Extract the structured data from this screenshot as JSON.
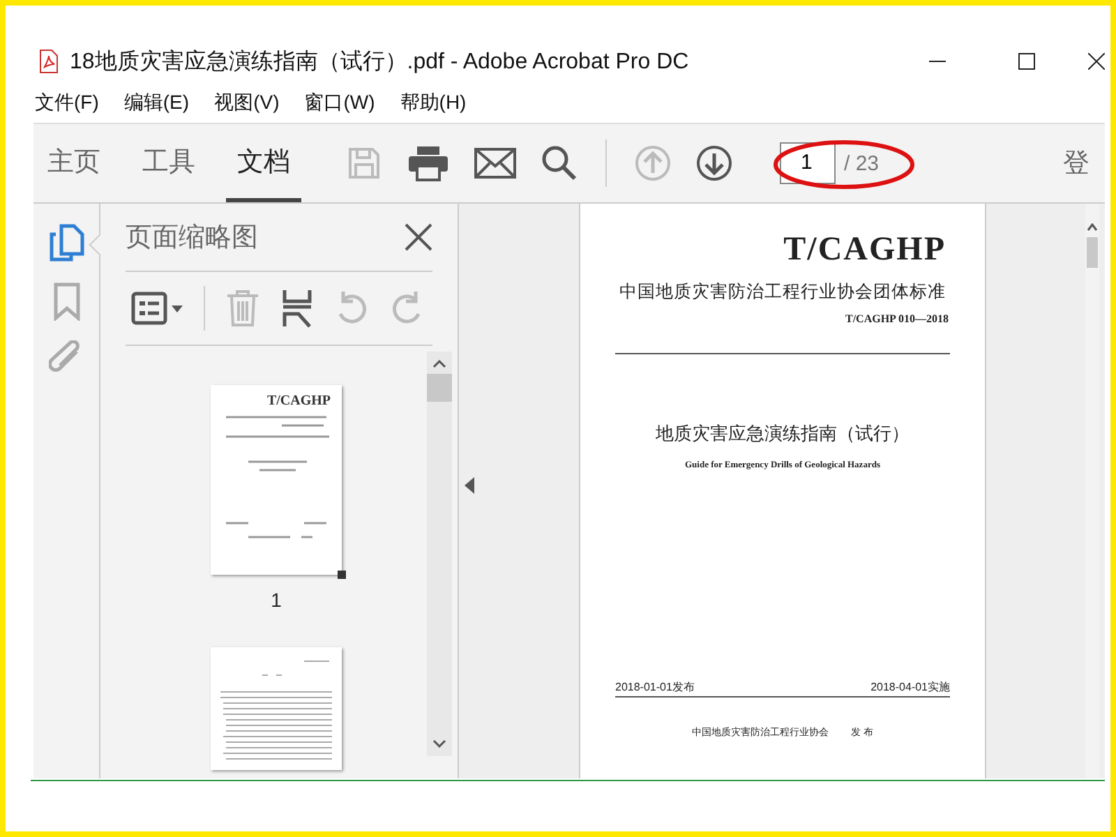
{
  "window": {
    "title": "18地质灾害应急演练指南（试行）.pdf - Adobe Acrobat Pro DC"
  },
  "menu": [
    "文件(F)",
    "编辑(E)",
    "视图(V)",
    "窗口(W)",
    "帮助(H)"
  ],
  "tabs": [
    {
      "label": "主页",
      "selected": false
    },
    {
      "label": "工具",
      "selected": false
    },
    {
      "label": "文档",
      "selected": true
    }
  ],
  "toolbar": {
    "buttons": [
      {
        "kind": "save",
        "disabled": true
      },
      {
        "kind": "print",
        "disabled": false
      },
      {
        "kind": "mail",
        "disabled": false
      },
      {
        "kind": "search",
        "disabled": false
      },
      {
        "kind": "up",
        "disabled": true
      },
      {
        "kind": "down",
        "disabled": false
      }
    ],
    "page_input": "1",
    "page_total": "/ 23",
    "sign_in": "登"
  },
  "side_rail": [
    {
      "kind": "pages",
      "selected": true
    },
    {
      "kind": "bookmarks",
      "selected": false
    },
    {
      "kind": "attachments",
      "selected": false
    }
  ],
  "thumbnail_panel": {
    "title": "页面缩略图",
    "tools": [
      {
        "kind": "options",
        "disabled": false
      },
      {
        "kind": "delete",
        "disabled": true
      },
      {
        "kind": "insert",
        "disabled": false
      },
      {
        "kind": "undo",
        "disabled": true
      },
      {
        "kind": "redo",
        "disabled": true
      }
    ],
    "thumbnails": [
      {
        "kind": "cover",
        "heading": "T/CAGHP",
        "label": "1"
      },
      {
        "kind": "contents"
      }
    ]
  },
  "document": {
    "code": "T/CAGHP",
    "org_standard": "中国地质灾害防治工程行业协会团体标准",
    "number": "T/CAGHP 010—2018",
    "title": "地质灾害应急演练指南（试行）",
    "title_en": "Guide for Emergency Drills of Geological Hazards",
    "issue_date": "2018-01-01发布",
    "effective_date": "2018-04-01实施",
    "publisher": "中国地质灾害防治工程行业协会",
    "publish_word": "发 布"
  }
}
